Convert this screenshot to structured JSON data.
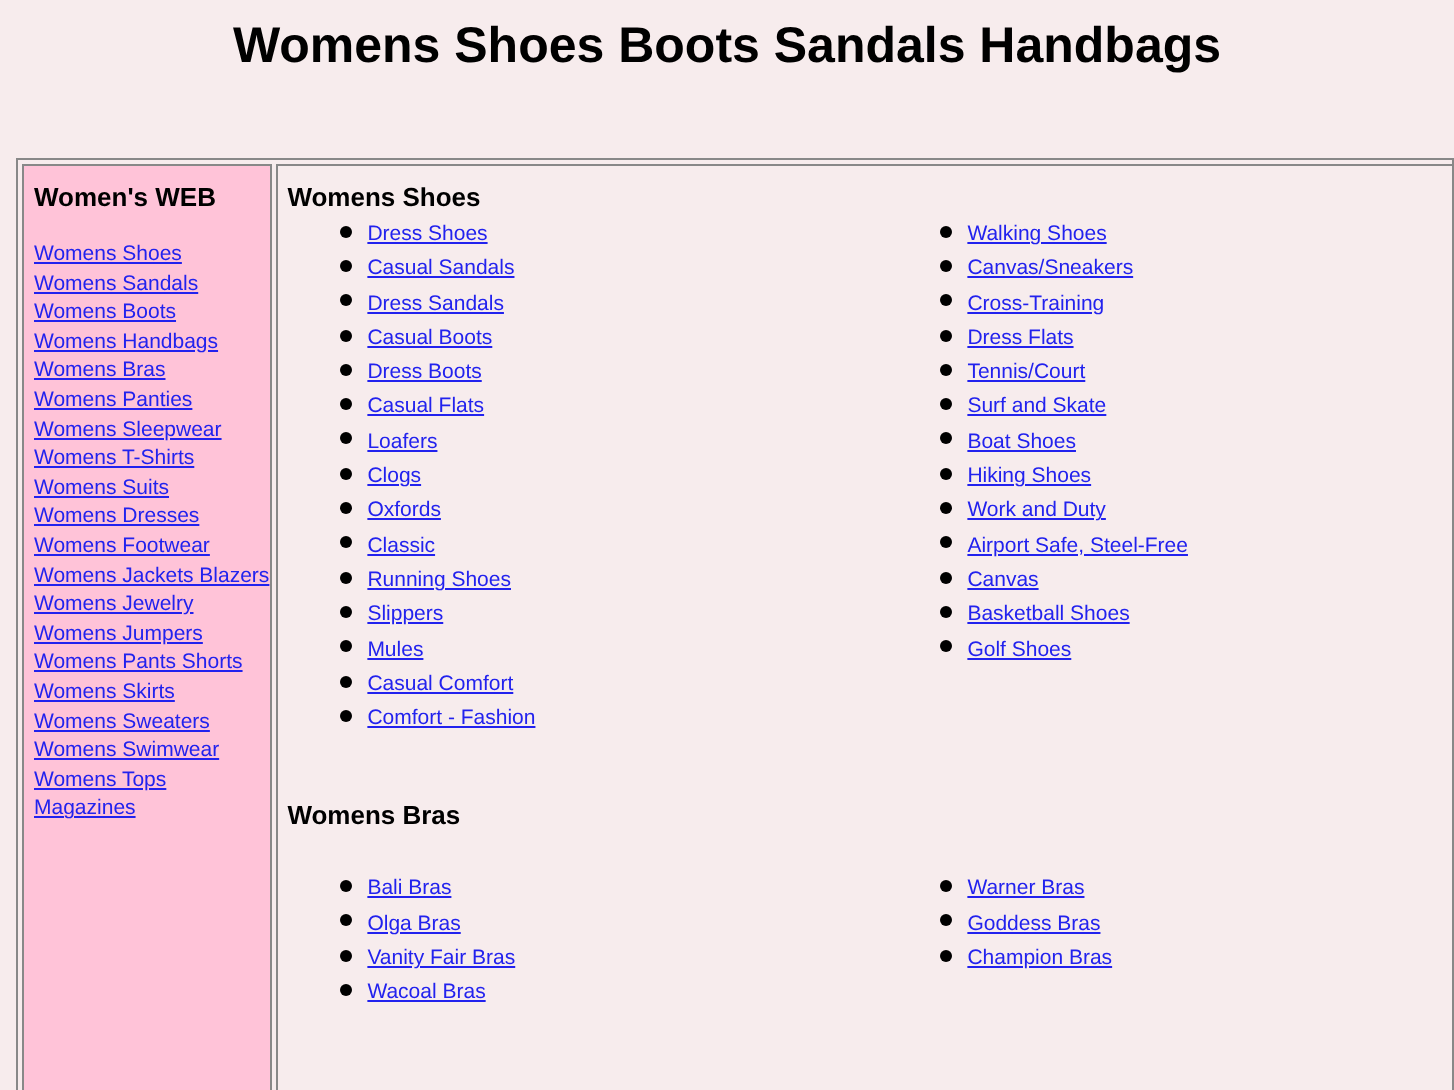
{
  "title": "Womens Shoes Boots Sandals Handbags",
  "sidebar": {
    "heading": "Women's WEB",
    "links": [
      "Womens Shoes",
      "Womens Sandals",
      "Womens Boots",
      "Womens Handbags",
      "Womens Bras",
      "Womens Panties",
      "Womens Sleepwear",
      "Womens T-Shirts",
      "Womens Suits",
      "Womens Dresses",
      "Womens Footwear",
      "Womens Jackets Blazers",
      "Womens Jewelry",
      "Womens Jumpers",
      "Womens Pants Shorts",
      "Womens Skirts",
      "Womens Sweaters",
      "Womens Swimwear",
      "Womens Tops",
      "Magazines"
    ]
  },
  "sections": [
    {
      "heading": "Womens Shoes",
      "columns": [
        [
          "Dress Shoes",
          "Casual Sandals",
          "Dress Sandals",
          "Casual Boots",
          "Dress Boots",
          "Casual Flats",
          "Loafers",
          "Clogs",
          "Oxfords",
          "Classic",
          "Running Shoes",
          "Slippers",
          "Mules",
          "Casual Comfort",
          "Comfort - Fashion"
        ],
        [
          "Walking Shoes",
          "Canvas/Sneakers",
          "Cross-Training",
          "Dress Flats",
          "Tennis/Court",
          "Surf and Skate",
          "Boat Shoes",
          "Hiking Shoes",
          "Work and Duty",
          "Airport Safe, Steel-Free",
          "Canvas",
          "Basketball Shoes",
          "Golf Shoes"
        ]
      ]
    },
    {
      "heading": "Womens Bras",
      "columns": [
        [
          "Bali Bras",
          "Olga Bras",
          "Vanity Fair Bras",
          "Wacoal Bras"
        ],
        [
          "Warner Bras",
          "Goddess Bras",
          "Champion Bras"
        ]
      ]
    }
  ]
}
